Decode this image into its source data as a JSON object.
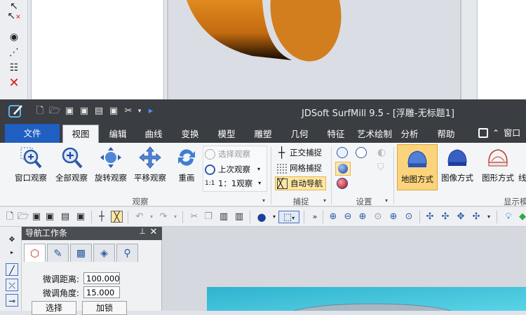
{
  "title_bar": {
    "app_name": "JDSoft SurfMill 9.5 - [浮雕-无标题1]"
  },
  "ribbon_tabs": [
    {
      "label": "文件"
    },
    {
      "label": "视图"
    },
    {
      "label": "编辑"
    },
    {
      "label": "曲线"
    },
    {
      "label": "变换"
    },
    {
      "label": "模型"
    },
    {
      "label": "雕塑"
    },
    {
      "label": "几何"
    },
    {
      "label": "特征"
    },
    {
      "label": "艺术绘制"
    },
    {
      "label": "分析"
    },
    {
      "label": "帮助"
    }
  ],
  "ribbon_right": {
    "window_label": "窗口"
  },
  "ribbon": {
    "view_group": {
      "label": "观察",
      "window_view": "窗口观察",
      "full_view": "全部观察",
      "rotate_view": "旋转观察",
      "pan_view": "平移观察",
      "redraw": "重画",
      "select_view": "选择观察",
      "last_view": "上次观察",
      "one_to_one": "1：1观察"
    },
    "snap_group": {
      "label": "捕捉",
      "ortho_snap": "正交捕捉",
      "grid_snap": "网格捕捉",
      "auto_nav": "自动导航"
    },
    "settings_group": {
      "label": "设置"
    },
    "display_group": {
      "label": "显示模",
      "map_mode": "地图方式",
      "image_mode": "图像方式",
      "graphic_mode": "图形方式",
      "line_mode": "线"
    }
  },
  "nav_panel": {
    "title": "导航工作条",
    "fine_distance_label": "微调距离:",
    "fine_distance_value": "100.000",
    "fine_angle_label": "微调角度:",
    "fine_angle_value": "15.000",
    "select_button": "选择",
    "lock_button": "加锁"
  },
  "colors": {
    "title_bg": "#3a3d42",
    "file_tab": "#1f5fc2",
    "active_highlight": "#fbd37c",
    "model_orange": "#d9821c",
    "viewport_cyan": "#39c6dc"
  }
}
